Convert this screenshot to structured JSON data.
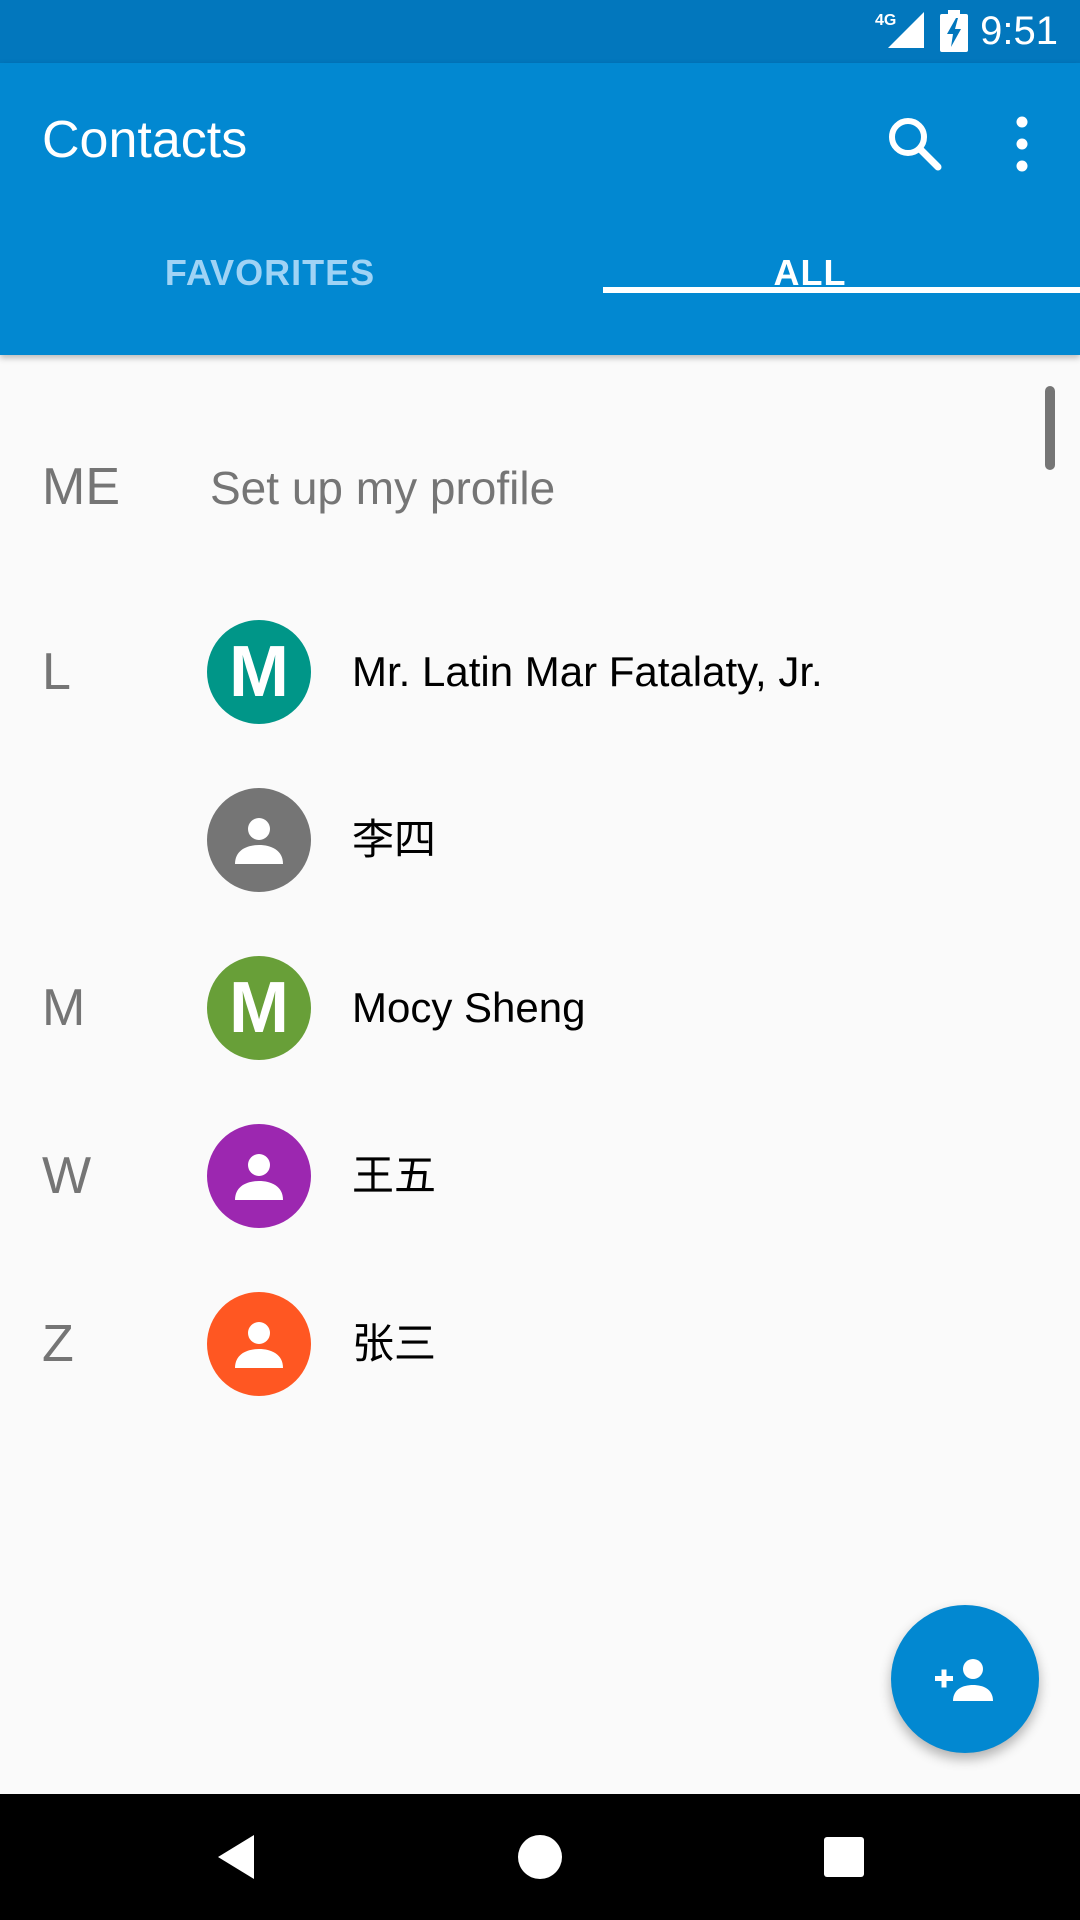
{
  "status_bar": {
    "network": "4G",
    "time": "9:51",
    "icons": [
      "signal-icon",
      "battery-charging-icon"
    ]
  },
  "app_bar": {
    "title": "Contacts",
    "actions": [
      "search-icon",
      "more-vert-icon"
    ],
    "color": "#0288d1"
  },
  "tabs": [
    {
      "label": "FAVORITES",
      "selected": false
    },
    {
      "label": "ALL",
      "selected": true
    }
  ],
  "me": {
    "letter": "ME",
    "label": "Set up my profile"
  },
  "contacts": [
    {
      "letter": "L",
      "avatar_text": "M",
      "avatar_icon": "",
      "avatar_color": "#009688",
      "name": "Mr. Latin Mar Fatalaty, Jr."
    },
    {
      "letter": "",
      "avatar_text": "",
      "avatar_icon": "person-icon",
      "avatar_color": "#757575",
      "name": "李四"
    },
    {
      "letter": "M",
      "avatar_text": "M",
      "avatar_icon": "",
      "avatar_color": "#689f38",
      "name": "Mocy Sheng"
    },
    {
      "letter": "W",
      "avatar_text": "",
      "avatar_icon": "person-icon",
      "avatar_color": "#9c27b0",
      "name": "王五"
    },
    {
      "letter": "Z",
      "avatar_text": "",
      "avatar_icon": "person-icon",
      "avatar_color": "#ff5722",
      "name": "张三"
    }
  ],
  "fab": {
    "icon": "add-person-icon"
  },
  "nav_bar": [
    "back-icon",
    "home-icon",
    "recents-icon"
  ]
}
